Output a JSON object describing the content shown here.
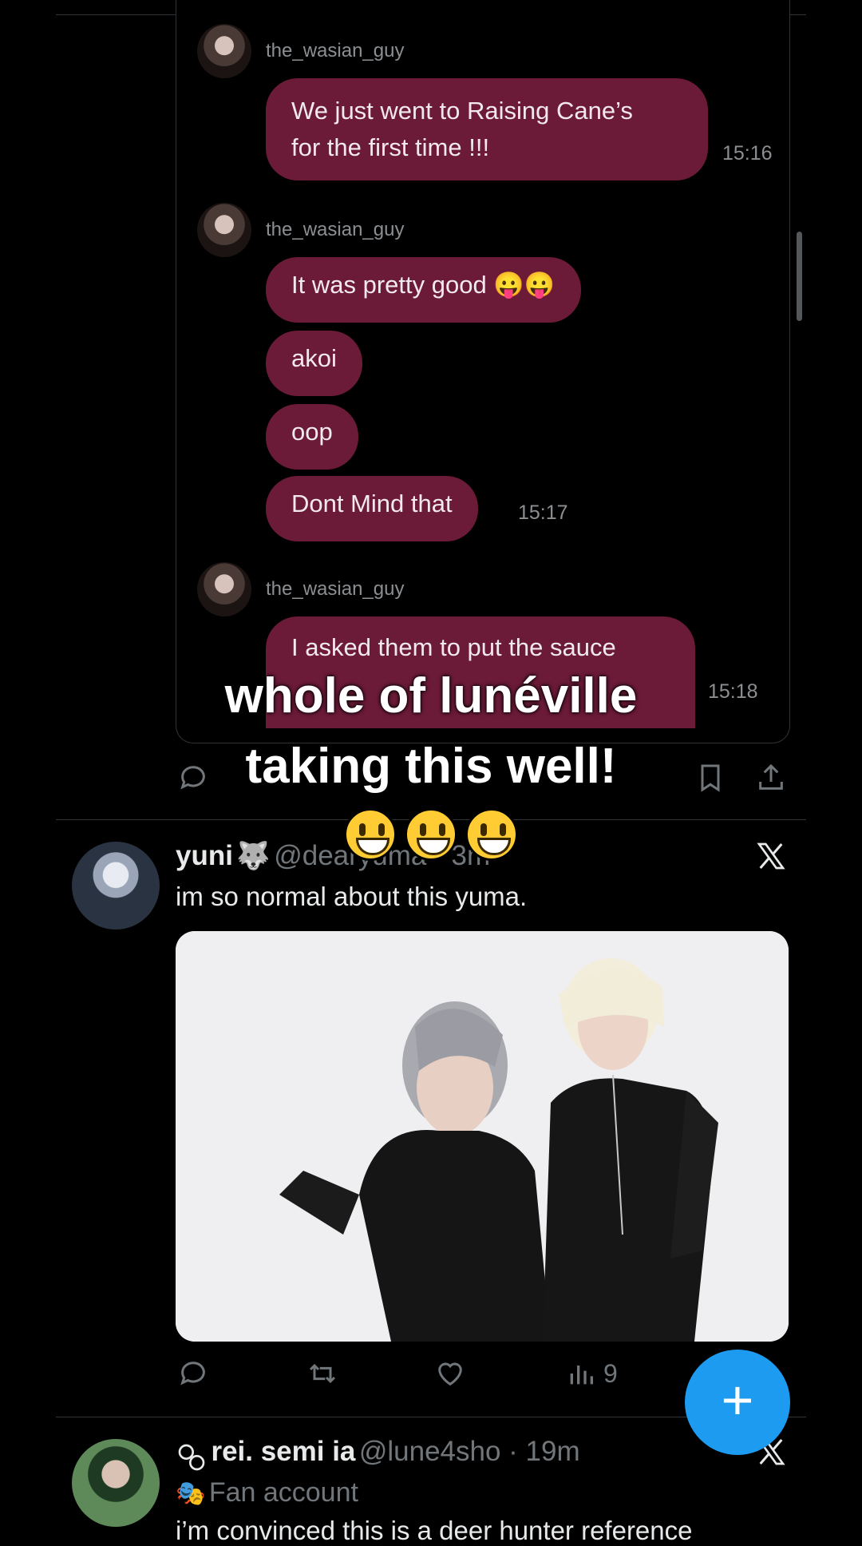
{
  "chat": {
    "groups": [
      {
        "username": "the_wasian_guy",
        "messages": [
          {
            "text": "We just went to Raising Cane’s for the first time !!!",
            "line1": "We just went to Raising Cane’s",
            "line2": "for the first time !!!"
          }
        ],
        "time": "15:16"
      },
      {
        "username": "the_wasian_guy",
        "messages": [
          {
            "text": "It was pretty good 😛😛"
          },
          {
            "text": "akoi"
          },
          {
            "text": "oop"
          },
          {
            "text": "Dont Mind that"
          }
        ],
        "time": "15:17"
      },
      {
        "username": "the_wasian_guy",
        "messages": [
          {
            "text": "I asked them to put the sauce"
          }
        ],
        "time": "15:18"
      }
    ]
  },
  "overlay_caption": {
    "line1": "whole of lunéville",
    "line2": "taking this well!",
    "emojis": [
      "smiling-face",
      "smiling-face",
      "smiling-face"
    ]
  },
  "posts": [
    {
      "name": "yuni",
      "name_emoji": "🐺",
      "handle": "@dearyuma · 3m",
      "text": "im so normal about this yuma.",
      "views": "9",
      "has_media": true
    },
    {
      "prefix_icon": "emblem",
      "name": "rei. semi ia",
      "handle": "@lune4sho · 19m",
      "bio": "Fan account",
      "bio_emoji": "🎭",
      "text": "i’m convinced this is a deer hunter reference"
    }
  ],
  "colors": {
    "bubble": "#6b1a38",
    "fab": "#1d9bf0",
    "background": "#000000"
  },
  "fab": {
    "label": "+"
  },
  "brand_icon": "x-logo-icon"
}
